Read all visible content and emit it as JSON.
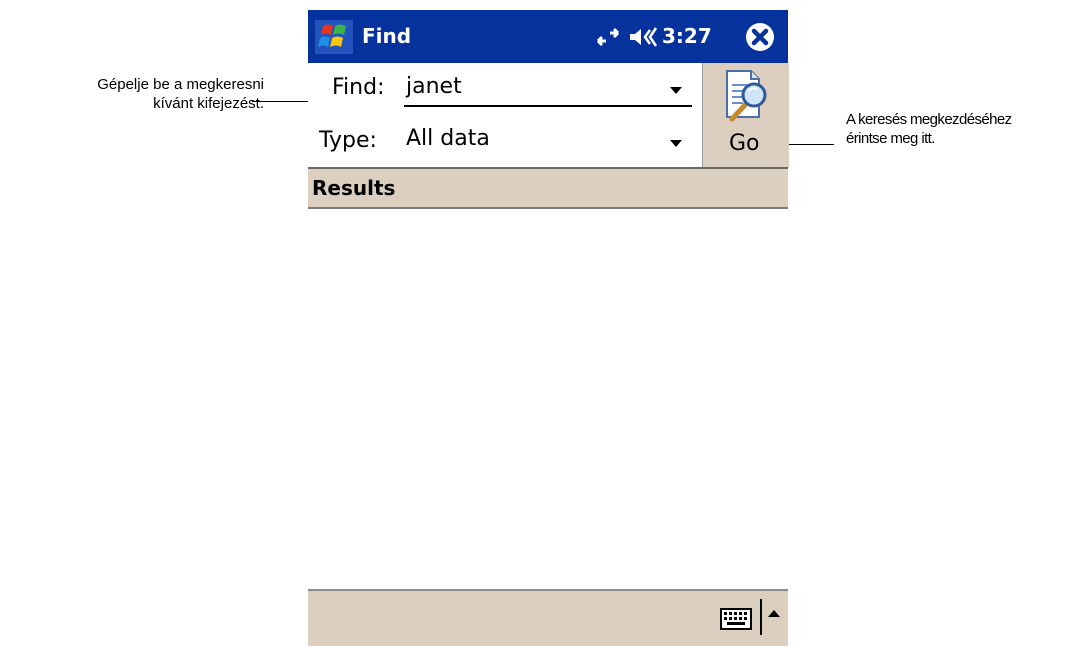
{
  "callouts": {
    "left": [
      "Gépelje be a megkeresni",
      "kívánt kifejezést."
    ],
    "right": [
      "A keresés megkezdéséhez",
      "érintse meg itt."
    ]
  },
  "titlebar": {
    "title": "Find",
    "time": "3:27",
    "icons": [
      "windows-start-icon",
      "connectivity-icon",
      "volume-icon",
      "close-icon"
    ],
    "color": "#06329e"
  },
  "search": {
    "find_label": "Find:",
    "find_value": "janet",
    "type_label": "Type:",
    "type_value": "All data",
    "go_label": "Go"
  },
  "results": {
    "header": "Results",
    "items": []
  },
  "menubar": {
    "icons": [
      "keyboard-icon",
      "sip-up-arrow-icon"
    ]
  },
  "colors": {
    "titlebar": "#06329e",
    "panel": "#dccfc0"
  }
}
